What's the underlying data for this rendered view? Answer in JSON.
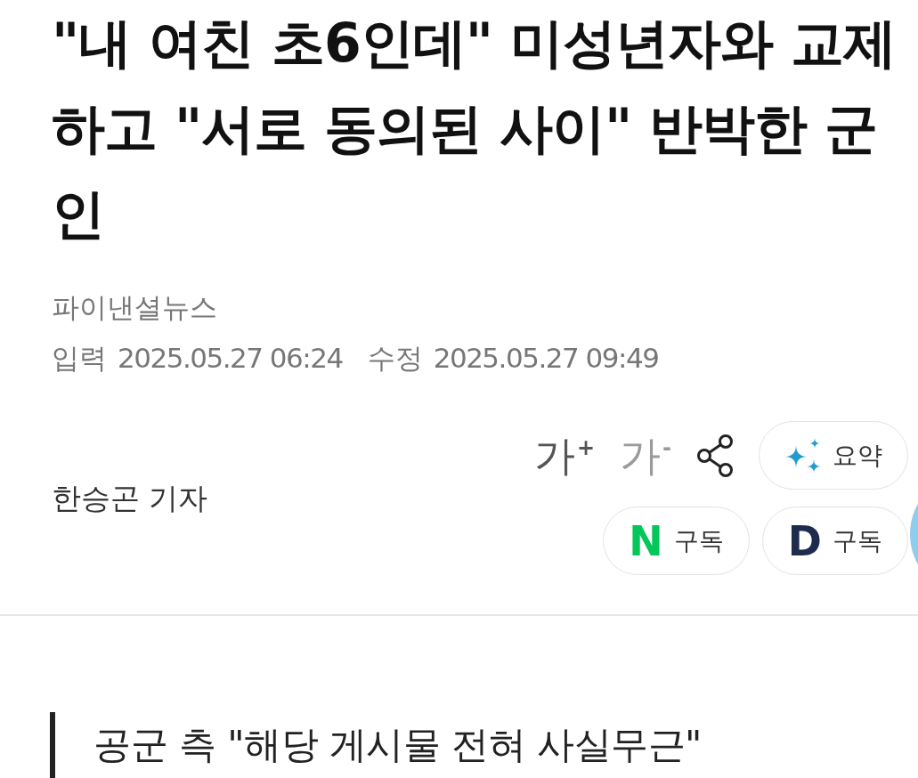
{
  "article": {
    "headline": "\"내 여친 초6인데\" 미성년자와 교제하고 \"서로 동의된 사이\" 반박한 군인",
    "press": "파이낸셜뉴스",
    "dates": [
      {
        "label": "입력",
        "value": "2025.05.27 06:24"
      },
      {
        "label": "수정",
        "value": "2025.05.27 09:49"
      }
    ]
  },
  "reporter": "한승곤 기자",
  "tools": [
    {
      "kind": "font-size",
      "label": "가$^{+}$",
      "disabled": false
    },
    {
      "kind": "font-size",
      "label": "가$^{-}$",
      "disabled": true
    },
    {
      "kind": "share"
    },
    {
      "kind": "summary",
      "label": "요약"
    }
  ],
  "subscriptions": [
    {
      "logo": "N",
      "color": "#03c75a",
      "label": "구독"
    },
    {
      "logo": "D",
      "color": "#1f2b4d",
      "label": "구독"
    }
  ],
  "section_heading": "공군 측 \"해당 게시물 전혀 사실무근\""
}
